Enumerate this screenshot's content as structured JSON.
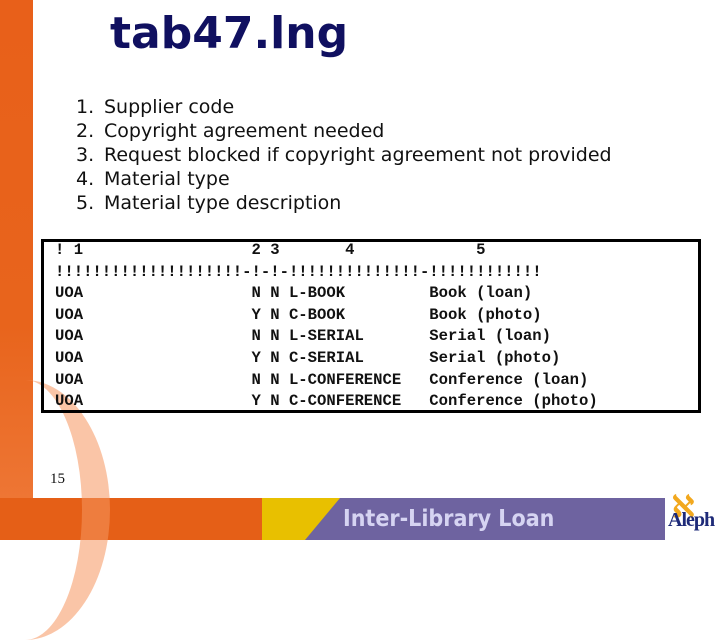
{
  "slide": {
    "title": "tab47.lng",
    "page_number": "15",
    "footer_title": "Inter-Library Loan",
    "logo_text": "Aleph",
    "colors": {
      "title": "#101060",
      "orange": "#e55f17",
      "yellow": "#e8c000",
      "purple": "#6e63a0",
      "footer_text": "#d6d4f2"
    }
  },
  "legend": [
    {
      "num": "1.",
      "text": "Supplier code"
    },
    {
      "num": "2.",
      "text": "Copyright agreement needed"
    },
    {
      "num": "3.",
      "text": "Request blocked if copyright agreement not provided"
    },
    {
      "num": "4.",
      "text": "Material type"
    },
    {
      "num": "5.",
      "text": "Material type description"
    }
  ],
  "table": {
    "header_line": "! 1                  2 3       4             5",
    "separator_line": "!!!!!!!!!!!!!!!!!!!!-!-!-!!!!!!!!!!!!!!-!!!!!!!!!!!!",
    "rows": [
      "UOA                  N N L-BOOK         Book (loan)",
      "UOA                  Y N C-BOOK         Book (photo)",
      "UOA                  N N L-SERIAL       Serial (loan)",
      "UOA                  Y N C-SERIAL       Serial (photo)",
      "UOA                  N N L-CONFERENCE   Conference (loan)",
      "UOA                  Y N C-CONFERENCE   Conference (photo)"
    ]
  }
}
